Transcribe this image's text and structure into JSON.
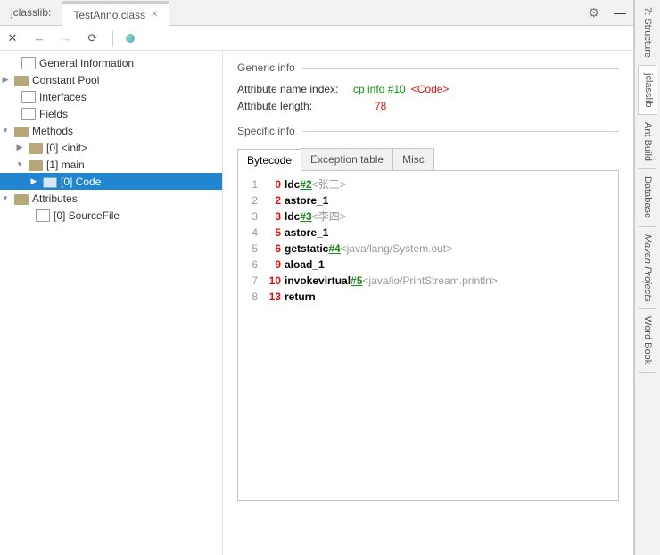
{
  "tabs": {
    "left": "jclasslib:",
    "active": "TestAnno.class"
  },
  "toolbar": {
    "close": "✕",
    "back": "←",
    "fwd": "→",
    "refresh": "⟳"
  },
  "tree": {
    "gen_info": "General Information",
    "const_pool": "Constant Pool",
    "interfaces": "Interfaces",
    "fields": "Fields",
    "methods": "Methods",
    "m0": "[0] <init>",
    "m1": "[1] main",
    "m1_code": "[0] Code",
    "attributes": "Attributes",
    "attr_src": "[0] SourceFile"
  },
  "detail": {
    "generic_label": "Generic info",
    "attr_name_label": "Attribute name index:",
    "attr_name_link": "cp info #10",
    "attr_name_suffix": "<Code>",
    "attr_len_label": "Attribute length:",
    "attr_len_value": "78",
    "specific_label": "Specific info",
    "subtabs": {
      "bytecode": "Bytecode",
      "exc": "Exception table",
      "misc": "Misc"
    }
  },
  "bytecode": [
    {
      "row": "1",
      "off": "0",
      "op": "ldc",
      "ref": "#2",
      "cmt": "<张三>"
    },
    {
      "row": "2",
      "off": "2",
      "op": "astore_1",
      "ref": "",
      "cmt": ""
    },
    {
      "row": "3",
      "off": "3",
      "op": "ldc",
      "ref": "#3",
      "cmt": "<李四>"
    },
    {
      "row": "4",
      "off": "5",
      "op": "astore_1",
      "ref": "",
      "cmt": ""
    },
    {
      "row": "5",
      "off": "6",
      "op": "getstatic",
      "ref": "#4",
      "cmt": "<java/lang/System.out>"
    },
    {
      "row": "6",
      "off": "9",
      "op": "aload_1",
      "ref": "",
      "cmt": ""
    },
    {
      "row": "7",
      "off": "10",
      "op": "invokevirtual",
      "ref": "#5",
      "cmt": "<java/io/PrintStream.println>"
    },
    {
      "row": "8",
      "off": "13",
      "op": "return",
      "ref": "",
      "cmt": ""
    }
  ],
  "rail": {
    "structure": "7: Structure",
    "jclasslib": "jclasslib",
    "ant": "Ant Build",
    "db": "Database",
    "maven": "Maven Projects",
    "wb": "Word Book"
  }
}
